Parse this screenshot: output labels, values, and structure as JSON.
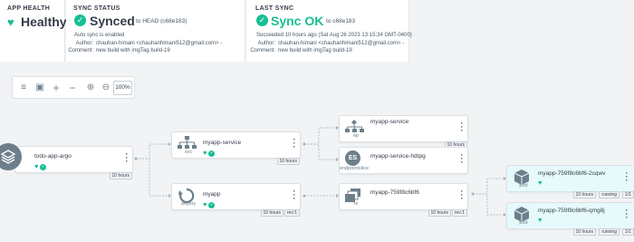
{
  "app_health": {
    "title": "APP HEALTH",
    "status": "Healthy"
  },
  "sync_status": {
    "title": "SYNC STATUS",
    "status": "Synced",
    "to_label": "to HEAD (c68e183)",
    "auto_sync": "Auto sync is enabled",
    "author_label": "Author:",
    "author": "chauhan-himani <chauhanhimani512@gmail.com> -",
    "comment_label": "Comment:",
    "comment": "new build with imgTag build-19"
  },
  "last_sync": {
    "title": "LAST SYNC",
    "status": "Sync OK",
    "to_label": "to c68e183",
    "succeeded": "Succeeded 10 hours ago (Sat Aug 26 2023 13:15:34 GMT-0400)",
    "author_label": "Author:",
    "author": "chauhan-himani <chauhanhimani512@gmail.com> -",
    "comment_label": "Comment:",
    "comment": "new build with imgTag build-19"
  },
  "toolbar": {
    "zoom": "100%"
  },
  "nodes": {
    "root": {
      "name": "todo-app-argo",
      "age": "10 hours"
    },
    "svc": {
      "name": "myapp-service",
      "kind": "svc",
      "age": "10 hours"
    },
    "deploy": {
      "name": "myapp",
      "kind": "deploy",
      "age": "10 hours",
      "rev": "rev:1"
    },
    "ep": {
      "name": "myapp-service",
      "kind": "ep",
      "age": "10 hours"
    },
    "eps": {
      "name": "myapp-service-hdtpg",
      "kind": "endpointslice",
      "badge": "ES"
    },
    "rs": {
      "name": "myapp-759f8c6bf6",
      "kind": "rs",
      "age": "10 hours",
      "rev": "rev:1"
    },
    "pod1": {
      "name": "myapp-759f8c6bf6-2cqwv",
      "kind": "pod",
      "age": "10 hours",
      "status": "running",
      "ratio": "1/1"
    },
    "pod2": {
      "name": "myapp-759f8c6bf6-qmg8j",
      "kind": "pod",
      "age": "10 hours",
      "status": "running",
      "ratio": "1/1"
    }
  },
  "colors": {
    "healthy": "#18be94",
    "link": "#0dadea",
    "edge": "#a3b1bb"
  }
}
